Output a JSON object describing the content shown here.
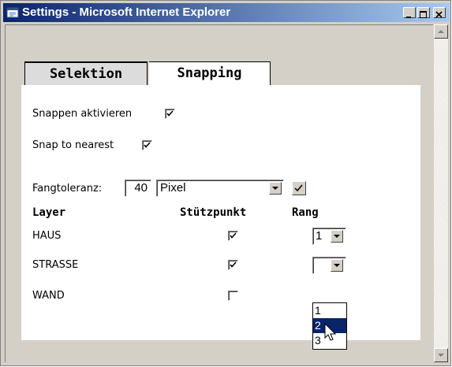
{
  "window": {
    "title": "Settings - Microsoft Internet Explorer",
    "controls": [
      "minimize",
      "maximize",
      "close"
    ]
  },
  "tabs": [
    {
      "label": "Selektion",
      "active": false
    },
    {
      "label": "Snapping",
      "active": true
    }
  ],
  "options": {
    "snap_activate_label": "Snappen aktivieren",
    "snap_activate_checked": true,
    "snap_nearest_label": "Snap to nearest",
    "snap_nearest_checked": true
  },
  "tolerance": {
    "label": "Fangtoleranz:",
    "value": "40",
    "unit": "Pixel"
  },
  "table": {
    "headers": [
      "Layer",
      "Stützpunkt",
      "Rang"
    ],
    "rows": [
      {
        "layer": "HAUS",
        "stuetzpunkt": true,
        "rang": "1"
      },
      {
        "layer": "STRASSE",
        "stuetzpunkt": true,
        "rang": ""
      },
      {
        "layer": "WAND",
        "stuetzpunkt": false,
        "rang": ""
      }
    ]
  },
  "rang_dropdown_options": [
    "1",
    "2",
    "3"
  ],
  "rang_dropdown_highlighted": "2",
  "colors": {
    "titlebar_start": "#0a246a",
    "titlebar_end": "#a6caf0",
    "selection": "#0a246a",
    "face": "#d4d0c8"
  }
}
